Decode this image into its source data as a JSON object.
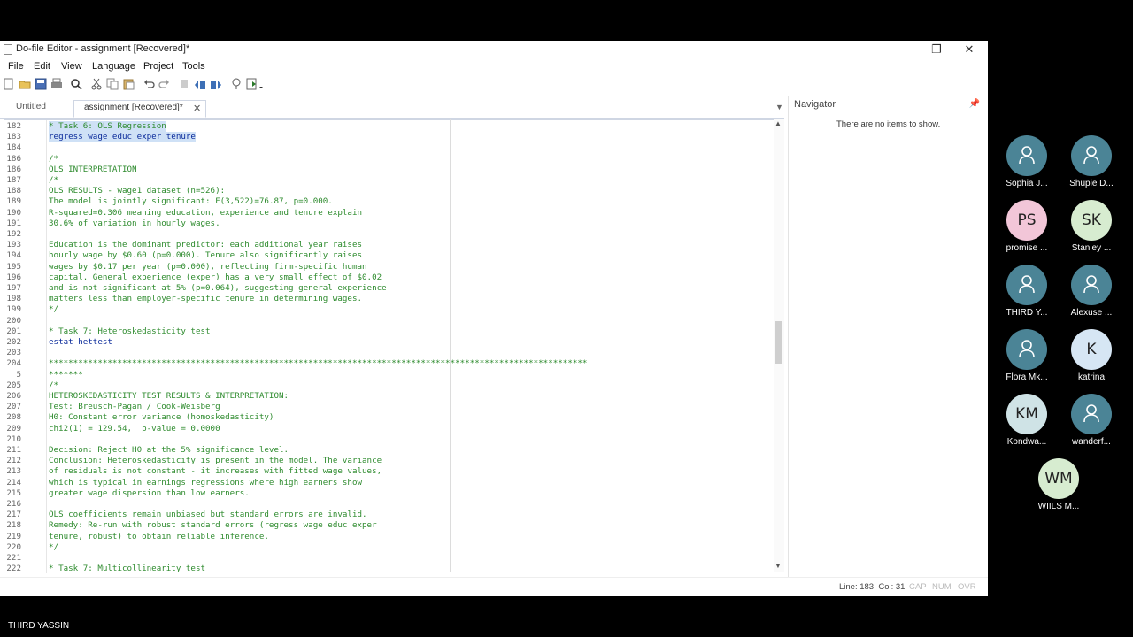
{
  "window": {
    "title": "Do-file Editor - assignment [Recovered]*"
  },
  "menu": [
    "File",
    "Edit",
    "View",
    "Language",
    "Project",
    "Tools"
  ],
  "tabs": [
    {
      "label": "Untitled"
    },
    {
      "label": "assignment [Recovered]*",
      "active": true
    }
  ],
  "editor": {
    "lines": [
      {
        "n": "182",
        "text": "* Task 6: OLS Regression",
        "type": "comment",
        "selected": true
      },
      {
        "n": "183",
        "text": "regress wage educ exper tenure",
        "type": "cmd",
        "selected": true
      },
      {
        "n": "184",
        "text": "",
        "type": "plain"
      },
      {
        "n": "186",
        "text": "/*",
        "type": "comment"
      },
      {
        "n": "186",
        "text": "OLS INTERPRETATION",
        "type": "comment"
      },
      {
        "n": "187",
        "text": "/*",
        "type": "comment"
      },
      {
        "n": "188",
        "text": "OLS RESULTS - wage1 dataset (n=526):",
        "type": "comment"
      },
      {
        "n": "189",
        "text": "The model is jointly significant: F(3,522)=76.87, p=0.000.",
        "type": "comment"
      },
      {
        "n": "190",
        "text": "R-squared=0.306 meaning education, experience and tenure explain",
        "type": "comment"
      },
      {
        "n": "191",
        "text": "30.6% of variation in hourly wages.",
        "type": "comment"
      },
      {
        "n": "192",
        "text": "",
        "type": "comment"
      },
      {
        "n": "193",
        "text": "Education is the dominant predictor: each additional year raises",
        "type": "comment"
      },
      {
        "n": "194",
        "text": "hourly wage by $0.60 (p=0.000). Tenure also significantly raises",
        "type": "comment"
      },
      {
        "n": "195",
        "text": "wages by $0.17 per year (p=0.000), reflecting firm-specific human",
        "type": "comment"
      },
      {
        "n": "196",
        "text": "capital. General experience (exper) has a very small effect of $0.02",
        "type": "comment"
      },
      {
        "n": "197",
        "text": "and is not significant at 5% (p=0.064), suggesting general experience",
        "type": "comment"
      },
      {
        "n": "198",
        "text": "matters less than employer-specific tenure in determining wages.",
        "type": "comment"
      },
      {
        "n": "199",
        "text": "*/",
        "type": "comment"
      },
      {
        "n": "200",
        "text": "",
        "type": "plain"
      },
      {
        "n": "201",
        "text": "* Task 7: Heteroskedasticity test",
        "type": "comment"
      },
      {
        "n": "202",
        "text": "estat hettest",
        "type": "cmd"
      },
      {
        "n": "203",
        "text": "",
        "type": "plain"
      },
      {
        "n": "204",
        "text": "**************************************************************************************************************",
        "type": "comment"
      },
      {
        "n": "5",
        "text": "*******",
        "type": "comment"
      },
      {
        "n": "205",
        "text": "/*",
        "type": "comment"
      },
      {
        "n": "206",
        "text": "HETEROSKEDASTICITY TEST RESULTS & INTERPRETATION:",
        "type": "comment"
      },
      {
        "n": "207",
        "text": "Test: Breusch-Pagan / Cook-Weisberg",
        "type": "comment"
      },
      {
        "n": "208",
        "text": "H0: Constant error variance (homoskedasticity)",
        "type": "comment"
      },
      {
        "n": "209",
        "text": "chi2(1) = 129.54,  p-value = 0.0000",
        "type": "comment"
      },
      {
        "n": "210",
        "text": "",
        "type": "comment"
      },
      {
        "n": "211",
        "text": "Decision: Reject H0 at the 5% significance level.",
        "type": "comment"
      },
      {
        "n": "212",
        "text": "Conclusion: Heteroskedasticity is present in the model. The variance",
        "type": "comment"
      },
      {
        "n": "213",
        "text": "of residuals is not constant - it increases with fitted wage values,",
        "type": "comment"
      },
      {
        "n": "214",
        "text": "which is typical in earnings regressions where high earners show",
        "type": "comment"
      },
      {
        "n": "215",
        "text": "greater wage dispersion than low earners.",
        "type": "comment"
      },
      {
        "n": "216",
        "text": "",
        "type": "comment"
      },
      {
        "n": "217",
        "text": "OLS coefficients remain unbiased but standard errors are invalid.",
        "type": "comment"
      },
      {
        "n": "218",
        "text": "Remedy: Re-run with robust standard errors (regress wage educ exper",
        "type": "comment"
      },
      {
        "n": "219",
        "text": "tenure, robust) to obtain reliable inference.",
        "type": "comment"
      },
      {
        "n": "220",
        "text": "*/",
        "type": "comment"
      },
      {
        "n": "221",
        "text": "",
        "type": "plain"
      },
      {
        "n": "222",
        "text": "* Task 7: Multicollinearity test",
        "type": "comment"
      }
    ]
  },
  "navigator": {
    "title": "Navigator",
    "empty_text": "There are no items to show."
  },
  "status": {
    "position": "Line: 183, Col: 31",
    "flags": [
      "CAP",
      "NUM",
      "OVR"
    ]
  },
  "participants": [
    {
      "name": "Sophia J...",
      "initials": "",
      "color": "#4b8496"
    },
    {
      "name": "Shupie D...",
      "initials": "",
      "color": "#4b8496"
    },
    {
      "name": "promise ...",
      "initials": "PS",
      "color": "#f2c6d8"
    },
    {
      "name": "Stanley ...",
      "initials": "SK",
      "color": "#d7ecd0"
    },
    {
      "name": "THIRD Y...",
      "initials": "",
      "color": "#4b8496"
    },
    {
      "name": "Alexuse ...",
      "initials": "",
      "color": "#4b8496"
    },
    {
      "name": "Flora Mk...",
      "initials": "",
      "color": "#4b8496"
    },
    {
      "name": "katrina",
      "initials": "K",
      "color": "#d6e6f4"
    },
    {
      "name": "Kondwa...",
      "initials": "KM",
      "color": "#cfe3e6"
    },
    {
      "name": "wanderf...",
      "initials": "",
      "color": "#4b8496"
    },
    {
      "name": "WIILS M...",
      "initials": "WM",
      "color": "#d7ecd0"
    }
  ],
  "bottom_label": "THIRD YASSIN"
}
